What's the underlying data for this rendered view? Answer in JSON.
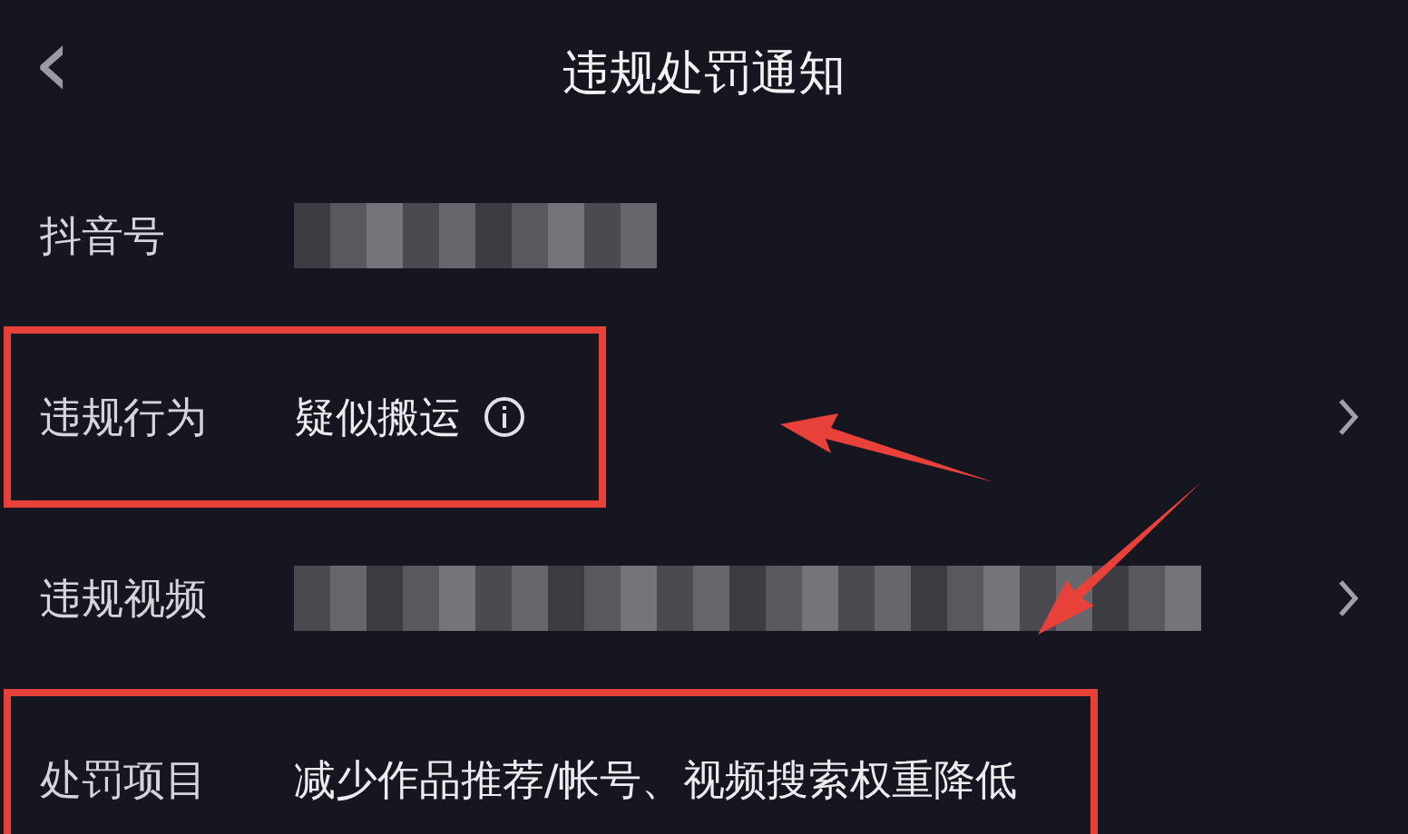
{
  "header": {
    "back_icon": "‹",
    "title": "违规处罚通知"
  },
  "rows": [
    {
      "label": "抖音号",
      "kind": "redacted",
      "highlighted": false,
      "chevron": false
    },
    {
      "label": "违规行为",
      "kind": "text",
      "value": "疑似搬运",
      "info": true,
      "highlighted": true,
      "chevron": true
    },
    {
      "label": "违规视频",
      "kind": "redacted",
      "highlighted": false,
      "chevron": true
    },
    {
      "label": "处罚项目",
      "kind": "text",
      "value": "减少作品推荐/帐号、视频搜索权重降低",
      "info": false,
      "highlighted": true,
      "chevron": false
    }
  ]
}
